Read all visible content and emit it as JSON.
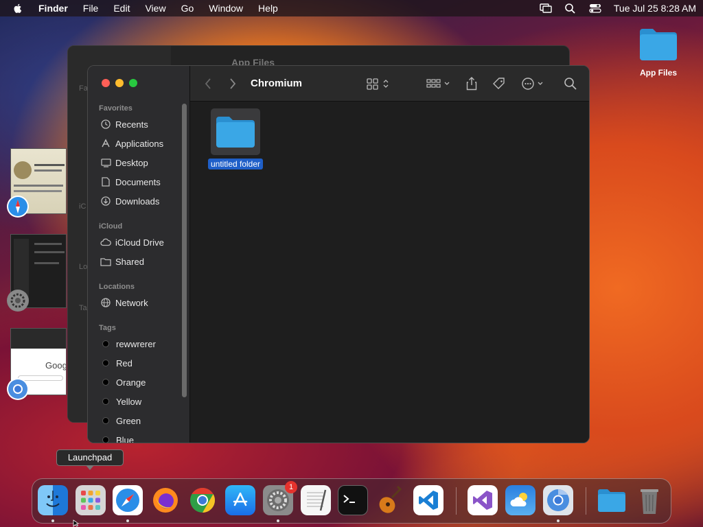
{
  "menubar": {
    "app_name": "Finder",
    "items": [
      "File",
      "Edit",
      "View",
      "Go",
      "Window",
      "Help"
    ],
    "datetime": "Tue Jul 25  8:28 AM"
  },
  "desktop": {
    "icon_label": "App Files"
  },
  "back_window": {
    "title": "App Files"
  },
  "finder": {
    "title": "Chromium",
    "sidebar": {
      "favorites_label": "Favorites",
      "favorites": [
        {
          "label": "Recents",
          "icon": "clock-icon"
        },
        {
          "label": "Applications",
          "icon": "applications-icon"
        },
        {
          "label": "Desktop",
          "icon": "desktop-icon"
        },
        {
          "label": "Documents",
          "icon": "document-icon"
        },
        {
          "label": "Downloads",
          "icon": "download-icon"
        }
      ],
      "icloud_label": "iCloud",
      "icloud": [
        {
          "label": "iCloud Drive",
          "icon": "cloud-icon"
        },
        {
          "label": "Shared",
          "icon": "shared-folder-icon"
        }
      ],
      "locations_label": "Locations",
      "locations": [
        {
          "label": "Network",
          "icon": "globe-icon"
        }
      ],
      "tags_label": "Tags",
      "tags": [
        "rewwrerer",
        "Red",
        "Orange",
        "Yellow",
        "Green",
        "Blue"
      ]
    },
    "files": [
      {
        "name": "untitled folder",
        "selected": true
      }
    ]
  },
  "tooltip": "Launchpad",
  "dock": {
    "apps": [
      "Finder",
      "Launchpad",
      "Safari",
      "Firefox",
      "Chrome",
      "App Store",
      "System Settings",
      "TextEdit",
      "Terminal",
      "GarageBand",
      "Visual Studio Code",
      "Visual Studio",
      "Weather",
      "Chromium",
      "Downloads",
      "Trash"
    ],
    "settings_badge": "1"
  },
  "colors": {
    "accent": "#1f5fc8",
    "folder": "#3aa7e6",
    "window_bg": "#1e1e1e"
  }
}
